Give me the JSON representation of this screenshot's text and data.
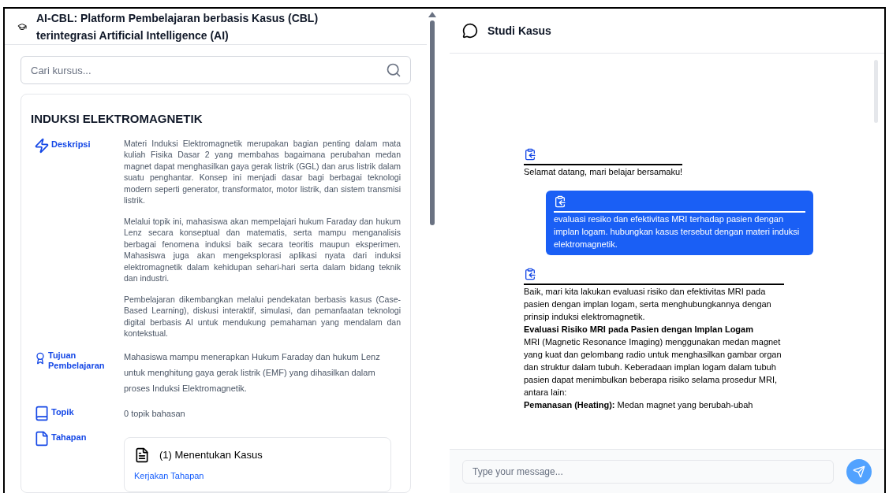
{
  "app_title": "AI-CBL: Platform Pembelajaran berbasis Kasus (CBL) terintegrasi Artificial Intelligence (AI)",
  "search": {
    "placeholder": "Cari kursus..."
  },
  "course": {
    "title": "INDUKSI ELEKTROMAGNETIK",
    "sections": [
      {
        "kind": "description",
        "label": "Deskripsi",
        "paragraphs": [
          "Materi Induksi Elektromagnetik merupakan bagian penting dalam mata kuliah Fisika Dasar 2 yang membahas bagaimana perubahan medan magnet dapat menghasilkan gaya gerak listrik (GGL) dan arus listrik dalam suatu penghantar. Konsep ini menjadi dasar bagi berbagai teknologi modern seperti generator, transformator, motor listrik, dan sistem transmisi listrik.",
          "Melalui topik ini, mahasiswa akan mempelajari hukum Faraday dan hukum Lenz secara konseptual dan matematis, serta mampu menganalisis berbagai fenomena induksi baik secara teoritis maupun eksperimen. Mahasiswa juga akan mengeksplorasi aplikasi nyata dari induksi elektromagnetik dalam kehidupan sehari-hari serta dalam bidang teknik dan industri.",
          "Pembelajaran dikembangkan melalui pendekatan berbasis kasus (Case-Based Learning), diskusi interaktif, simulasi, dan pemanfaatan teknologi digital berbasis AI untuk mendukung pemahaman yang mendalam dan kontekstual."
        ]
      },
      {
        "kind": "goal",
        "label": "Tujuan Pembelajaran",
        "paragraphs": [
          "Mahasiswa mampu menerapkan Hukum Faraday dan hukum Lenz untuk menghitung gaya gerak listrik (EMF) yang dihasilkan dalam proses Induksi Elektromagnetik."
        ]
      },
      {
        "kind": "topic",
        "label": "Topik",
        "paragraphs": [
          "0 topik bahasan"
        ]
      },
      {
        "kind": "stages",
        "label": "Tahapan",
        "stages": [
          {
            "title": "(1) Menentukan Kasus",
            "action": "Kerjakan Tahapan"
          }
        ]
      }
    ]
  },
  "chat": {
    "title": "Studi Kasus",
    "messages": [
      {
        "kind": "bot",
        "lines": [
          {
            "kind": "para",
            "text": "Selamat datang, mari belajar bersamaku!"
          }
        ]
      },
      {
        "kind": "user",
        "lines": [
          {
            "kind": "para",
            "text": "evaluasi resiko dan efektivitas MRI terhadap pasien dengan implan logam. hubungkan kasus tersebut dengan materi induksi elektromagnetik."
          }
        ]
      },
      {
        "kind": "bot",
        "lines": [
          {
            "kind": "para",
            "text": "Baik, mari kita lakukan evaluasi risiko dan efektivitas MRI pada pasien dengan implan logam, serta menghubungkannya dengan prinsip induksi elektromagnetik."
          },
          {
            "kind": "heading",
            "text": "Evaluasi Risiko MRI pada Pasien dengan Implan Logam"
          },
          {
            "kind": "para",
            "text": "MRI (Magnetic Resonance Imaging) menggunakan medan magnet yang kuat dan gelombang radio untuk menghasilkan gambar organ dan struktur dalam tubuh. Keberadaan implan logam dalam tubuh pasien dapat menimbulkan beberapa risiko selama prosedur MRI, antara lain:"
          },
          {
            "kind": "para",
            "text": "**Pemanasan (Heating):** Medan magnet yang berubah-ubah"
          }
        ]
      }
    ],
    "input": {
      "placeholder": "Type your message..."
    },
    "send": {
      "disabled": true
    }
  }
}
